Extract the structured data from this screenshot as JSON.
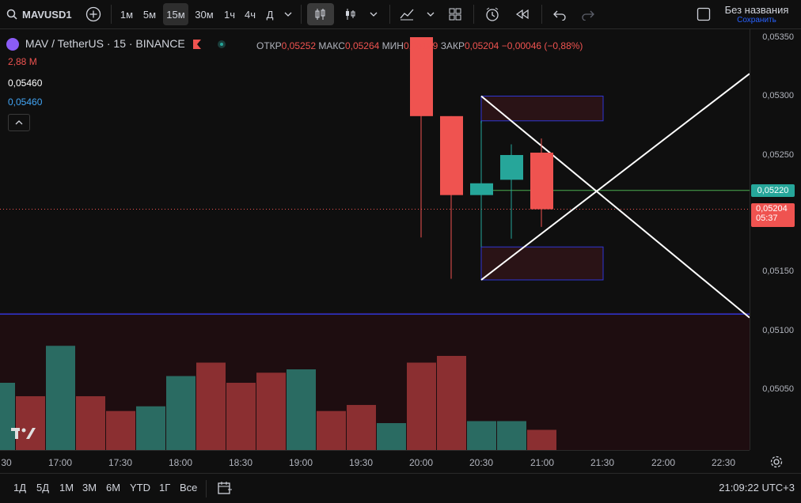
{
  "toolbar": {
    "symbol": "MAVUSD1",
    "intervals": [
      "1м",
      "5м",
      "15м",
      "30м",
      "1ч",
      "4ч",
      "Д"
    ],
    "active_interval": "15м",
    "layout_title": "Без названия",
    "save_label": "Сохранить"
  },
  "legend": {
    "title": "MAV / TetherUS · 15 · BINANCE",
    "open_label": "ОТКР",
    "open": "0,05252",
    "high_label": "МАКС",
    "high": "0,05264",
    "low_label": "МИН",
    "low": "0,05189",
    "close_label": "ЗАКР",
    "close": "0,05204",
    "change": "−0,00046 (−0,88%)"
  },
  "indicators": {
    "vol": "2,88 М",
    "val1": "0,05460",
    "val2": "0,05460"
  },
  "price_axis": {
    "ticks": [
      "0,05350",
      "0,05300",
      "0,05250",
      "0,05200",
      "0,05150",
      "0,05100",
      "0,05050"
    ],
    "green_label": "0,05220",
    "last_price": "0,05204",
    "countdown": "05:37"
  },
  "time_axis": {
    "ticks": [
      "30",
      "17:00",
      "17:30",
      "18:00",
      "18:30",
      "19:00",
      "19:30",
      "20:00",
      "20:30",
      "21:00",
      "21:30",
      "22:00",
      "22:30"
    ]
  },
  "bottom": {
    "ranges": [
      "1Д",
      "5Д",
      "1М",
      "3М",
      "6М",
      "YTD",
      "1Г",
      "Все"
    ],
    "clock": "21:09:22 UTC+3"
  },
  "chart_data": {
    "type": "candlestick",
    "candles": [
      {
        "time": "20:00",
        "open": 0.0535,
        "high": 0.0535,
        "low": 0.0518,
        "close": 0.05283
      },
      {
        "time": "20:15",
        "open": 0.05283,
        "high": 0.05283,
        "low": 0.05145,
        "close": 0.05216
      },
      {
        "time": "20:30",
        "open": 0.05216,
        "high": 0.05277,
        "low": 0.05172,
        "close": 0.05226
      },
      {
        "time": "20:45",
        "open": 0.05229,
        "high": 0.05259,
        "low": 0.05179,
        "close": 0.0525
      },
      {
        "time": "21:00",
        "open": 0.05252,
        "high": 0.05264,
        "low": 0.05189,
        "close": 0.05204
      }
    ],
    "volume": [
      {
        "time": "16:30",
        "value": 1.0,
        "dir": "up"
      },
      {
        "time": "16:45",
        "value": 0.8,
        "dir": "down"
      },
      {
        "time": "17:00",
        "value": 1.55,
        "dir": "up"
      },
      {
        "time": "17:15",
        "value": 0.8,
        "dir": "down"
      },
      {
        "time": "17:30",
        "value": 0.58,
        "dir": "down"
      },
      {
        "time": "17:45",
        "value": 0.65,
        "dir": "up"
      },
      {
        "time": "18:00",
        "value": 1.1,
        "dir": "up"
      },
      {
        "time": "18:15",
        "value": 1.3,
        "dir": "down"
      },
      {
        "time": "18:30",
        "value": 1.0,
        "dir": "down"
      },
      {
        "time": "18:45",
        "value": 1.15,
        "dir": "down"
      },
      {
        "time": "19:00",
        "value": 1.2,
        "dir": "up"
      },
      {
        "time": "19:15",
        "value": 0.58,
        "dir": "down"
      },
      {
        "time": "19:30",
        "value": 0.67,
        "dir": "down"
      },
      {
        "time": "19:45",
        "value": 0.4,
        "dir": "up"
      },
      {
        "time": "20:00",
        "value": 1.3,
        "dir": "down"
      },
      {
        "time": "20:15",
        "value": 1.4,
        "dir": "down"
      },
      {
        "time": "20:30",
        "value": 0.43,
        "dir": "up"
      },
      {
        "time": "20:45",
        "value": 0.43,
        "dir": "up"
      },
      {
        "time": "21:00",
        "value": 0.3,
        "dir": "down"
      }
    ],
    "levels": {
      "green_line": 0.0522,
      "last_price": 0.05204,
      "blue_line": 0.05115
    },
    "colors": {
      "up": "#26a69a",
      "down": "#ef5350",
      "vol_up": "#2a6b62",
      "vol_down": "#8b2f31",
      "blue": "#2f36d6"
    }
  }
}
